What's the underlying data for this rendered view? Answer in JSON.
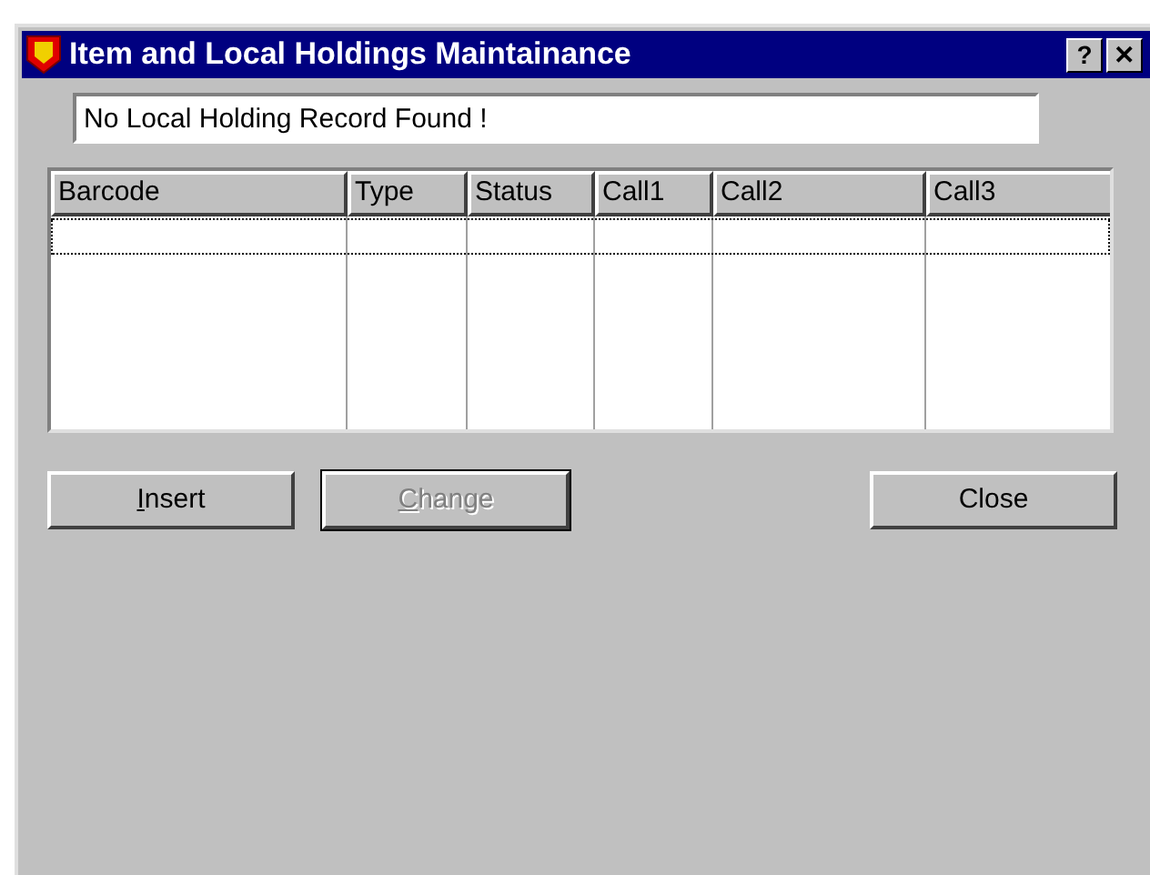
{
  "window": {
    "title": "Item and Local Holdings Maintainance",
    "buttons": [
      {
        "label": "?"
      },
      {
        "label": "✕"
      }
    ]
  },
  "message": {
    "value": "No Local Holding Record Found !"
  },
  "table": {
    "columns": [
      "Barcode",
      "Type",
      "Status",
      "Call1",
      "Call2",
      "Call3"
    ],
    "rows": [
      {
        "focused": true
      }
    ]
  },
  "buttons": [
    {
      "access": "I",
      "rest": "nsert",
      "disabled": false,
      "default": false
    },
    {
      "access": "C",
      "rest": "hange",
      "disabled": true,
      "default": true
    },
    {
      "rest": "Close",
      "disabled": false,
      "default": false
    }
  ]
}
